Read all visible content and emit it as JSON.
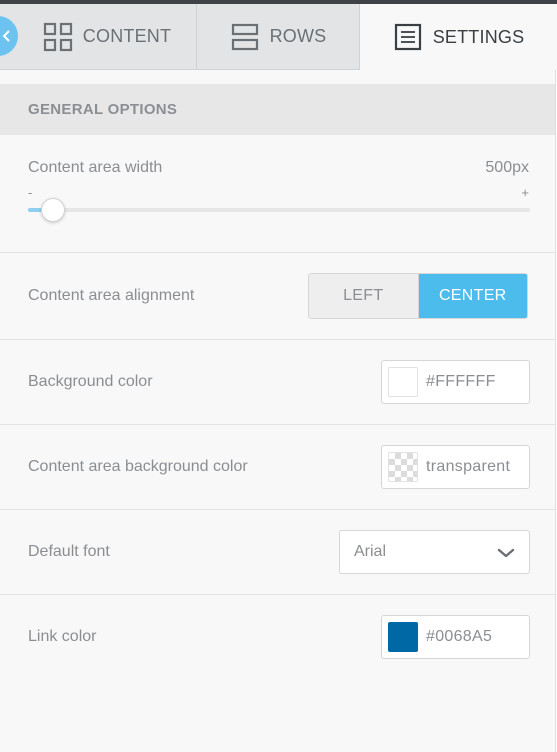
{
  "tabs": {
    "content_label": "CONTENT",
    "rows_label": "ROWS",
    "settings_label": "SETTINGS",
    "active": "settings"
  },
  "general_options": {
    "title": "GENERAL OPTIONS"
  },
  "content_area_width": {
    "label": "Content area width",
    "value_text": "500px",
    "min_label": "-",
    "max_label": "+",
    "slider_fraction": 0.05
  },
  "content_area_alignment": {
    "label": "Content area alignment",
    "options": [
      "LEFT",
      "CENTER"
    ],
    "selected": "CENTER"
  },
  "background_color": {
    "label": "Background color",
    "value": "#FFFFFF"
  },
  "content_area_background_color": {
    "label": "Content area background color",
    "value": "transparent"
  },
  "default_font": {
    "label": "Default font",
    "value": "Arial"
  },
  "link_color": {
    "label": "Link color",
    "value": "#0068A5"
  },
  "colors": {
    "accent": "#4BBCEC",
    "slider_fill": "#8FD0F2",
    "link_swatch": "#0068A5",
    "background_swatch": "#FFFFFF",
    "tab_inactive_bg": "#E2E4E6",
    "panel_bg": "#F8F8F8"
  },
  "icons": {
    "content_tab": "grid-icon",
    "rows_tab": "rows-icon",
    "settings_tab": "settings-document-icon",
    "font_dropdown": "chevron-down-icon",
    "handle": "chevron-left-icon"
  }
}
